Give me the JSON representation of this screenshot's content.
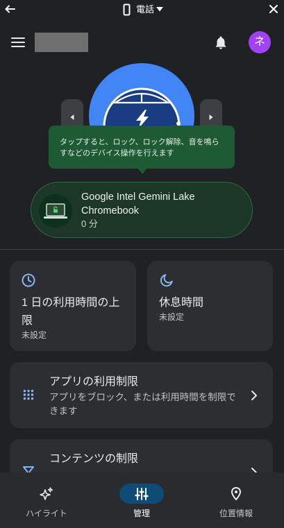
{
  "theme": {
    "background": "#202124",
    "surface": "#2d2e31",
    "accent_blue": "#8ab4f8",
    "hero_blue": "#4285f4",
    "tooltip_green": "#1e5b35",
    "avatar_purple": "#a142f4",
    "nav_active": "#0f4c75"
  },
  "window_bar": {
    "back_icon": "arrow-left-icon",
    "device_icon": "phone-icon",
    "device_label": "電話",
    "dropdown_icon": "dropdown-triangle-icon",
    "close_icon": "close-icon"
  },
  "app_bar": {
    "menu_icon": "hamburger-menu-icon",
    "notifications_icon": "bell-icon",
    "avatar_initial": "ネ"
  },
  "hero": {
    "illustration": "device-illustration",
    "prev_icon": "chevron-left-icon",
    "next_icon": "chevron-right-icon"
  },
  "tooltip": {
    "text": "タップすると、ロック、ロック解除、音を鳴らすなどのデバイス操作を行えます"
  },
  "device_card": {
    "icon": "laptop-icon",
    "name": "Google Intel Gemini Lake Chromebook",
    "usage": "0 分"
  },
  "cards": {
    "daily_limit": {
      "icon": "clock-icon",
      "title": "1 日の利用時間の上限",
      "status": "未設定"
    },
    "downtime": {
      "icon": "moon-icon",
      "title": "休息時間",
      "status": "未設定"
    },
    "app_limits": {
      "icon": "apps-grid-icon",
      "title": "アプリの利用制限",
      "subtitle": "アプリをブロック、または利用時間を制限できます",
      "chevron": "chevron-right-icon"
    },
    "content_restrictions": {
      "icon": "filter-icon",
      "title": "コンテンツの制限",
      "chevron": "chevron-right-icon"
    }
  },
  "bottom_nav": {
    "items": [
      {
        "label": "ハイライト",
        "icon": "sparkle-icon",
        "active": false
      },
      {
        "label": "管理",
        "icon": "tune-icon",
        "active": true
      },
      {
        "label": "位置情報",
        "icon": "location-pin-icon",
        "active": false
      }
    ]
  }
}
